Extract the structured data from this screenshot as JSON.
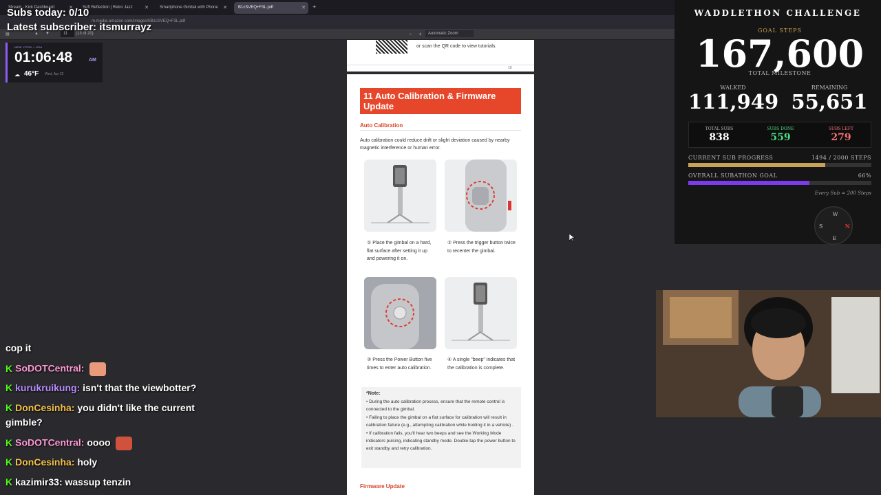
{
  "browser": {
    "tabs": [
      {
        "label": "Stream - Kick Dashboard"
      },
      {
        "label": "Soft Reflection | Retro Jazz"
      },
      {
        "label": "Smartphone Gimbal with Phone"
      },
      {
        "label": "B1cSVEQ+F3L.pdf"
      }
    ],
    "new_tab_label": "+",
    "url": "m.media-amazon.com/images/I/B1cSVEQ+F3L.pdf"
  },
  "pdf_toolbar": {
    "page_number": "11",
    "page_count": "(13 of 20)",
    "zoom_minus": "−",
    "zoom_plus": "+",
    "zoom": "Automatic Zoom"
  },
  "overlay": {
    "subs_today": "Subs today: 0/10",
    "latest_subscriber": "Latest subscriber: itsmurrayz"
  },
  "clock": {
    "location": "NEW YORK • USA",
    "time": "01:06:48",
    "ampm": "AM",
    "temp": "46°F",
    "date": "Wed, Apr 22"
  },
  "pdf": {
    "prev_page_text": "or scan the QR code to view tutorials.",
    "prev_page_number": "10",
    "section_title": "11 Auto Calibration & Firmware Update",
    "subsection": "Auto Calibration",
    "intro": "Auto calibration could reduce drift or slight deviation caused by nearby magnetic interference or human error.",
    "steps": [
      {
        "caption": "① Place the gimbal on a hard, flat surface after setting it up and powering it on."
      },
      {
        "caption": "② Press the trigger button twice to recenter the gimbal."
      },
      {
        "caption": "③ Press the Power Button five times to enter auto calibration."
      },
      {
        "caption": "④ A single \"beep\" indicates that the calibration is complete."
      }
    ],
    "note_title": "*Note:",
    "notes": [
      "• During the auto calibration process, ensure that the remote control is connected to the gimbal.",
      "• Failing to place the gimbal on a flat surface for calibration will result in calibration failure (e.g., attempting calibration while holding it in a vehicle) .",
      "• If calibration fails, you'll hear two beeps and see the Working Mode indicators pulsing, indicating standby mode. Double-tap the power button to exit standby and retry calibration."
    ],
    "firmware_title": "Firmware Update"
  },
  "chat": [
    {
      "user": "",
      "message": "cop it"
    },
    {
      "user": "SoDOTCentral:",
      "message": "",
      "color": "#ff9ad5"
    },
    {
      "user": "kurukruikung:",
      "message": "isn't that the viewbotter?",
      "color": "#b98cff"
    },
    {
      "user": "DonCesinha:",
      "message": "you didn't like the current",
      "color": "#f5c04a"
    },
    {
      "user": "",
      "message": "gimble?"
    },
    {
      "user": "SoDOTCentral:",
      "message": "oooo",
      "color": "#ff9ad5"
    },
    {
      "user": "DonCesinha:",
      "message": "holy",
      "color": "#f5c04a"
    },
    {
      "user": "kazimir33:",
      "message": "wassup tenzin",
      "color": "#ffffff"
    }
  ],
  "stats": {
    "title": "WADDLETHON CHALLENGE",
    "goal_label": "GOAL STEPS",
    "goal_value": "167,600",
    "total_milestone": "TOTAL MILESTONE",
    "walked_label": "WALKED",
    "walked_value": "111,949",
    "remaining_label": "REMAINING",
    "remaining_value": "55,651",
    "total_subs_label": "TOTAL SUBS",
    "total_subs": "838",
    "subs_done_label": "SUBS DONE",
    "subs_done": "559",
    "subs_left_label": "SUBS LEFT",
    "subs_left": "279",
    "current_label": "CURRENT SUB PROGRESS",
    "current_value": "1494 / 2000 STEPS",
    "current_fraction": 0.747,
    "overall_label": "OVERALL SUBATHON GOAL",
    "overall_value": "66%",
    "overall_fraction": 0.66,
    "footnote": "Every Sub = 200 Steps",
    "compass": {
      "n": "W",
      "s": "E",
      "e": "N",
      "w": "S"
    }
  }
}
